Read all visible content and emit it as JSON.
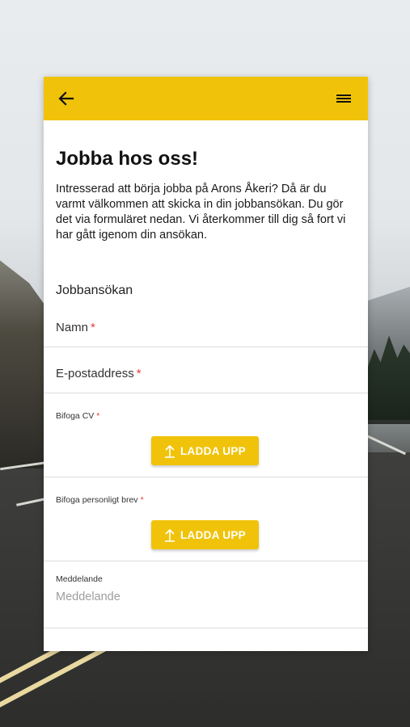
{
  "appbar": {
    "back_icon": "arrow-left-icon",
    "menu_icon": "hamburger-menu-icon",
    "color": "#f0c30a"
  },
  "page": {
    "title": "Jobba hos oss!",
    "intro": "Intresserad att börja jobba på Arons Åkeri? Då är du varmt välkommen att skicka in din jobbansökan. Du gör det via formuläret nedan. Vi återkommer till dig så fort vi har gått igenom din ansökan."
  },
  "form": {
    "title": "Jobbansökan",
    "name_label": "Namn",
    "email_label": "E-postaddress",
    "required_mark": "*",
    "cv_label": "Bifoga CV",
    "letter_label": "Bifoga personligt brev",
    "upload_label": "LADDA UPP",
    "upload_icon": "upload-icon",
    "message_label": "Meddelande",
    "message_placeholder": "Meddelande",
    "accent_color": "#f0c30a",
    "required_color": "#e53935"
  }
}
